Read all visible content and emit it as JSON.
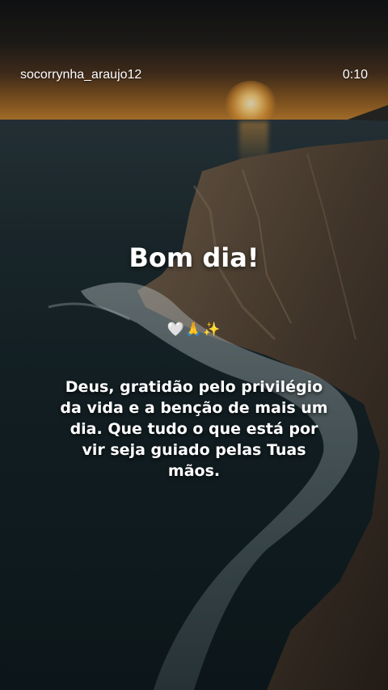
{
  "story": {
    "username": "socorrynha_araujo12",
    "time": "0:10"
  },
  "content": {
    "title": "Bom dia!",
    "emoji": "🤍🙏✨",
    "message": "Deus, gratidão pelo privilégio da vida e a benção de mais um dia. Que tudo o que está por vir seja guiado pelas Tuas mãos."
  }
}
